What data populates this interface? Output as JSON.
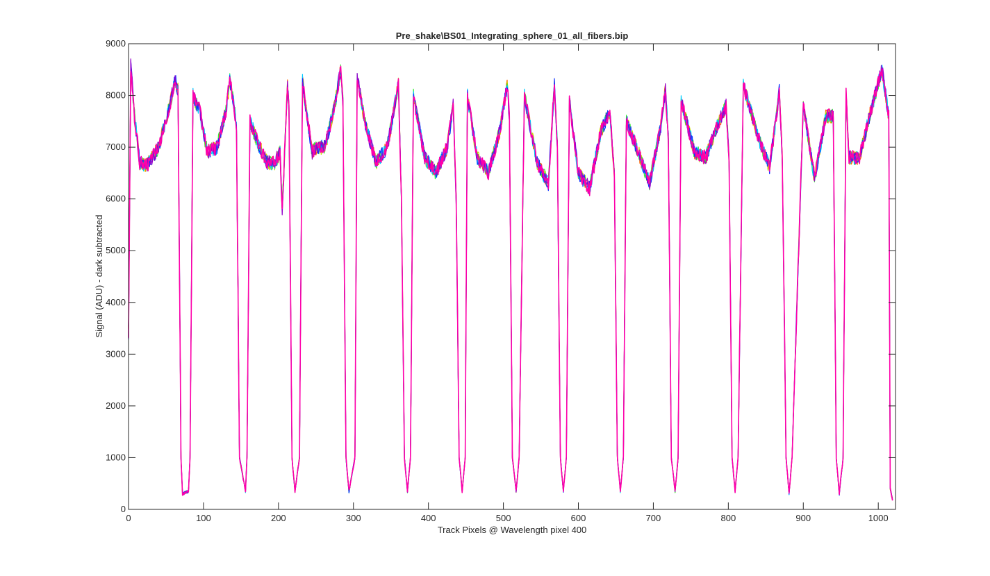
{
  "chart_data": {
    "type": "line",
    "title": "Pre_shake\\BS01_Integrating_sphere_01_all_fibers.bip",
    "xlabel": "Track Pixels @ Wavelength pixel 400",
    "ylabel": "Signal (ADU) - dark subtracted",
    "xlim": [
      0,
      1023
    ],
    "ylim": [
      0,
      9000
    ],
    "x_ticks": [
      0,
      100,
      200,
      300,
      400,
      500,
      600,
      700,
      800,
      900,
      1000
    ],
    "y_ticks": [
      0,
      1000,
      2000,
      3000,
      4000,
      5000,
      6000,
      7000,
      8000,
      9000
    ],
    "grid": false,
    "legend": "none",
    "series_colors": [
      "#ff6600",
      "#ccdd00",
      "#33ee33",
      "#00ccff",
      "#1133ff",
      "#9900cc",
      "#ff00aa"
    ],
    "profile": {
      "description_points_x": [
        0,
        3,
        8,
        15,
        25,
        40,
        55,
        62,
        66,
        70,
        72,
        80,
        82,
        86,
        95,
        105,
        118,
        130,
        135,
        140,
        144,
        148,
        156,
        158,
        162,
        172,
        185,
        195,
        202,
        205,
        212,
        214,
        218,
        222,
        228,
        232,
        236,
        245,
        248,
        252,
        262,
        275,
        283,
        286,
        290,
        294,
        302,
        305,
        315,
        330,
        345,
        355,
        360,
        364,
        368,
        372,
        376,
        380,
        395,
        410,
        425,
        433,
        437,
        441,
        445,
        449,
        452,
        465,
        480,
        495,
        505,
        508,
        512,
        517,
        521,
        528,
        545,
        560,
        568,
        572,
        576,
        580,
        584,
        588,
        600,
        615,
        630,
        642,
        648,
        652,
        656,
        660,
        664,
        680,
        695,
        710,
        716,
        720,
        724,
        729,
        733,
        737,
        755,
        770,
        785,
        797,
        801,
        805,
        809,
        813,
        820,
        840,
        855,
        865,
        868,
        872,
        877,
        881,
        885,
        900,
        915,
        930,
        940,
        944,
        948,
        953,
        957,
        961,
        975,
        990,
        1005,
        1014,
        1016,
        1019,
        1023
      ],
      "description_points_y": [
        3400,
        8600,
        7600,
        6700,
        6650,
        7000,
        7800,
        8300,
        8100,
        1000,
        300,
        350,
        1000,
        8000,
        7700,
        6900,
        7000,
        7700,
        8300,
        7900,
        7400,
        1000,
        350,
        1000,
        7500,
        7100,
        6700,
        6700,
        6900,
        5800,
        8200,
        7800,
        1000,
        350,
        1000,
        8300,
        7800,
        6900,
        6950,
        7000,
        7000,
        7800,
        8500,
        7900,
        1000,
        350,
        1000,
        8400,
        7500,
        6700,
        7000,
        7800,
        8200,
        6000,
        1000,
        350,
        1000,
        8000,
        6800,
        6500,
        7000,
        7800,
        6000,
        1000,
        350,
        1000,
        8000,
        6800,
        6500,
        7300,
        8200,
        7600,
        1000,
        350,
        1000,
        8000,
        6700,
        6300,
        8200,
        7000,
        1000,
        350,
        1000,
        7900,
        6500,
        6200,
        7300,
        7700,
        6500,
        1000,
        350,
        1000,
        7500,
        6900,
        6300,
        7400,
        8100,
        7200,
        1000,
        350,
        1000,
        7900,
        6900,
        6800,
        7400,
        7800,
        6800,
        1000,
        350,
        1000,
        8200,
        7200,
        6600,
        7700,
        8100,
        6800,
        1000,
        300,
        1000,
        7800,
        6400,
        7600,
        7600,
        1000,
        300,
        1000,
        8000,
        6800,
        6800,
        7700,
        8500,
        7600,
        400,
        200
      ]
    }
  }
}
